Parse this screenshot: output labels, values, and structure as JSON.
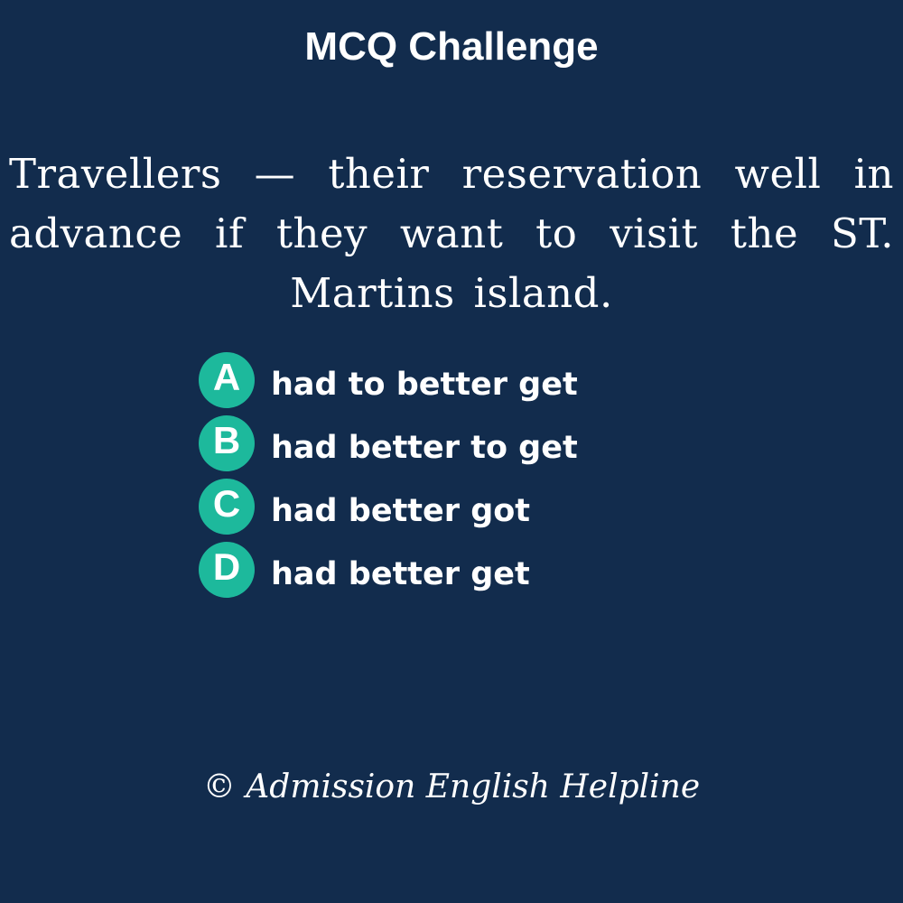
{
  "title": "MCQ Challenge",
  "question": "Travellers — their reservation well in advance if they want to visit the ST. Martins island.",
  "options": [
    {
      "letter": "A",
      "text": "had to better get"
    },
    {
      "letter": "B",
      "text": "had better to get"
    },
    {
      "letter": "C",
      "text": "had better got"
    },
    {
      "letter": "D",
      "text": "had better get"
    }
  ],
  "footer": "© Admission English Helpline",
  "colors": {
    "background": "#122c4d",
    "badge": "#1db99c",
    "text": "#ffffff"
  }
}
